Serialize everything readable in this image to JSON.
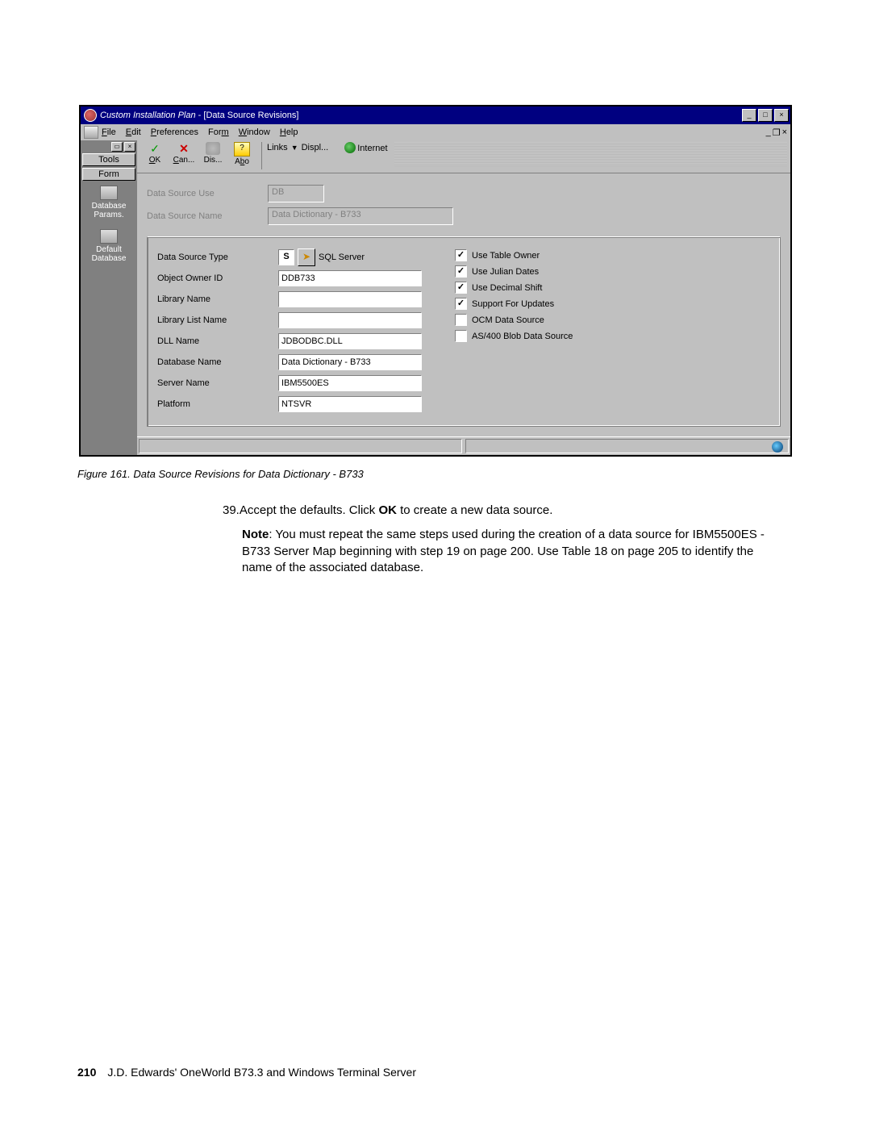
{
  "window": {
    "title_app": "Custom Installation Plan",
    "title_doc": " - [Data Source Revisions]",
    "min": "_",
    "max": "□",
    "close": "×",
    "mdi_min": "_",
    "mdi_restore": "❐",
    "mdi_close": "×"
  },
  "menu": {
    "file": "File",
    "edit": "Edit",
    "preferences": "Preferences",
    "form": "Form",
    "window": "Window",
    "help": "Help"
  },
  "sidebar": {
    "tools_title": "Tools",
    "form_title": "Form",
    "item1": "Database Params.",
    "item2": "Default Database"
  },
  "toolbar": {
    "ok": "OK",
    "can": "Can...",
    "dis": "Dis...",
    "abo": "Abo",
    "links": "Links",
    "displ": "Displ...",
    "internet": "Internet"
  },
  "static": {
    "l_use": "Data Source Use",
    "v_use": "DB",
    "l_name": "Data Source Name",
    "v_name": "Data Dictionary - B733"
  },
  "fields": {
    "l_type": "Data Source Type",
    "v_type_code": "S",
    "v_type_text": "SQL Server",
    "l_owner": "Object Owner ID",
    "v_owner": "DDB733",
    "l_lib": "Library Name",
    "v_lib": "",
    "l_liblist": "Library List Name",
    "v_liblist": "",
    "l_dll": "DLL Name",
    "v_dll": "JDBODBC.DLL",
    "l_db": "Database Name",
    "v_db": "Data Dictionary - B733",
    "l_srv": "Server Name",
    "v_srv": "IBM5500ES",
    "l_plat": "Platform",
    "v_plat": "NTSVR"
  },
  "checks": {
    "c1": "Use Table Owner",
    "c2": "Use Julian Dates",
    "c3": "Use Decimal Shift",
    "c4": "Support For Updates",
    "c5": "OCM Data Source",
    "c6": "AS/400 Blob Data Source"
  },
  "caption": "Figure 161.  Data Source Revisions for Data Dictionary - B733",
  "body": {
    "step_num": "39.",
    "step_a": "Accept the defaults. Click ",
    "step_b": "OK",
    "step_c": " to create a new data source.",
    "note_b": "Note",
    "note_t": ": You must repeat the same steps used during the creation of a data source for IBM5500ES - B733 Server Map beginning with step 19 on page 200. Use Table 18 on page 205 to identify the name of the associated database."
  },
  "footer": {
    "page": "210",
    "book": "J.D. Edwards' OneWorld B73.3 and Windows Terminal Server"
  }
}
